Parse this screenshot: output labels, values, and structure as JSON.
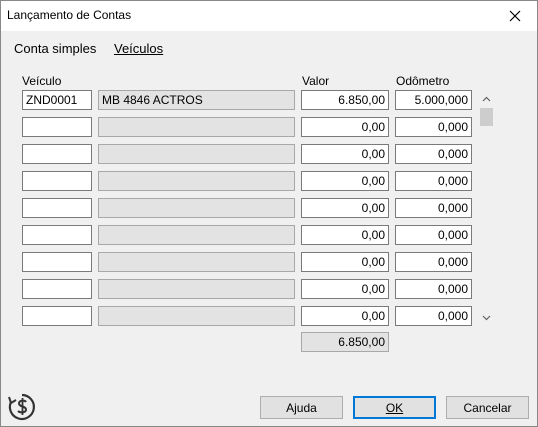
{
  "window": {
    "title": "Lançamento de Contas"
  },
  "tabs": [
    {
      "label": "Conta simples"
    },
    {
      "label": "Veículos"
    }
  ],
  "columns": {
    "vehicle": "Veículo",
    "value": "Valor",
    "odometer": "Odômetro"
  },
  "rows": [
    {
      "code": "ZND0001",
      "desc": "MB 4846 ACTROS",
      "value": "6.850,00",
      "odometer": "5.000,000"
    },
    {
      "code": "",
      "desc": "",
      "value": "0,00",
      "odometer": "0,000"
    },
    {
      "code": "",
      "desc": "",
      "value": "0,00",
      "odometer": "0,000"
    },
    {
      "code": "",
      "desc": "",
      "value": "0,00",
      "odometer": "0,000"
    },
    {
      "code": "",
      "desc": "",
      "value": "0,00",
      "odometer": "0,000"
    },
    {
      "code": "",
      "desc": "",
      "value": "0,00",
      "odometer": "0,000"
    },
    {
      "code": "",
      "desc": "",
      "value": "0,00",
      "odometer": "0,000"
    },
    {
      "code": "",
      "desc": "",
      "value": "0,00",
      "odometer": "0,000"
    },
    {
      "code": "",
      "desc": "",
      "value": "0,00",
      "odometer": "0,000"
    }
  ],
  "total": "6.850,00",
  "buttons": {
    "help": "Ajuda",
    "ok": "OK",
    "cancel": "Cancelar"
  }
}
